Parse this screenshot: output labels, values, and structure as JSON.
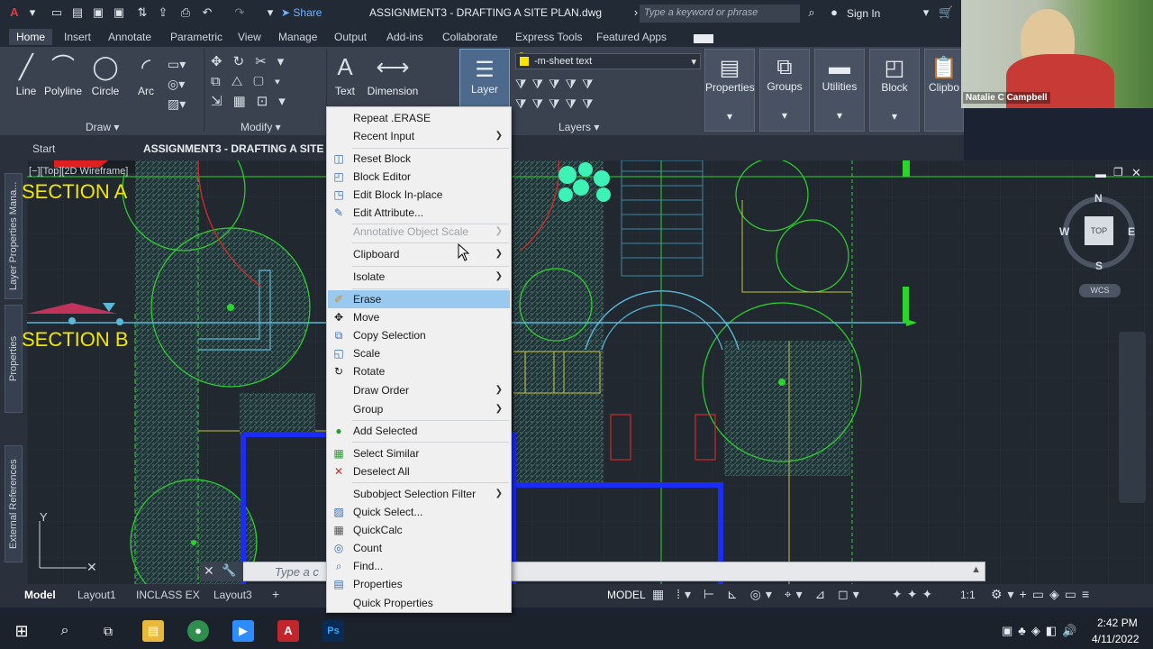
{
  "titlebar": {
    "share_label": "Share",
    "document_title": "ASSIGNMENT3 - DRAFTING A SITE PLAN.dwg",
    "search_placeholder": "Type a keyword or phrase",
    "signin_label": "Sign In"
  },
  "ribbon_tabs": [
    "Home",
    "Insert",
    "Annotate",
    "Parametric",
    "View",
    "Manage",
    "Output",
    "Add-ins",
    "Collaborate",
    "Express Tools",
    "Featured Apps"
  ],
  "ribbon": {
    "draw_tools": [
      "Line",
      "Polyline",
      "Circle",
      "Arc"
    ],
    "panel_draw": "Draw",
    "panel_modify": "Modify",
    "text_label": "Text",
    "dimension_label": "Dimension",
    "layer_label": "Layer",
    "layer_current": "-m-sheet text",
    "panel_layers": "Layers",
    "right_tools": [
      "Properties",
      "Groups",
      "Utilities",
      "Block",
      "Clipbo"
    ]
  },
  "doc_tabs": {
    "start": "Start",
    "active": "ASSIGNMENT3 - DRAFTING A SITE P"
  },
  "viewport": {
    "label": "[−][Top][2D Wireframe]",
    "section_a": "SECTION A",
    "section_b": "SECTION B"
  },
  "side_palettes": [
    "Layer Properties Mana...",
    "Properties",
    "External References"
  ],
  "viewcube": {
    "top": "TOP",
    "n": "N",
    "s": "S",
    "e": "E",
    "w": "W",
    "wcs": "WCS"
  },
  "command_placeholder": "Type a c",
  "model_tabs": [
    "Model",
    "Layout1",
    "INCLASS EX",
    "Layout3"
  ],
  "statusbar": {
    "model": "MODEL",
    "scale": "1:1"
  },
  "context_menu": [
    {
      "label": "Repeat .ERASE",
      "icon": "",
      "submenu": false
    },
    {
      "label": "Recent Input",
      "icon": "",
      "submenu": true
    },
    {
      "label": "Reset Block",
      "icon": "reset-block-icon",
      "submenu": false
    },
    {
      "label": "Block Editor",
      "icon": "block-editor-icon",
      "submenu": false
    },
    {
      "label": "Edit Block In-place",
      "icon": "edit-block-icon",
      "submenu": false
    },
    {
      "label": "Edit Attribute...",
      "icon": "edit-attribute-icon",
      "submenu": false
    },
    {
      "label": "Annotative Object Scale",
      "icon": "",
      "submenu": true,
      "disabled": true
    },
    {
      "label": "Clipboard",
      "icon": "",
      "submenu": true
    },
    {
      "label": "Isolate",
      "icon": "",
      "submenu": true
    },
    {
      "label": "Erase",
      "icon": "erase-icon",
      "submenu": false,
      "selected": true
    },
    {
      "label": "Move",
      "icon": "move-icon",
      "submenu": false
    },
    {
      "label": "Copy Selection",
      "icon": "copy-icon",
      "submenu": false
    },
    {
      "label": "Scale",
      "icon": "scale-icon",
      "submenu": false
    },
    {
      "label": "Rotate",
      "icon": "rotate-icon",
      "submenu": false
    },
    {
      "label": "Draw Order",
      "icon": "",
      "submenu": true
    },
    {
      "label": "Group",
      "icon": "",
      "submenu": true
    },
    {
      "label": "Add Selected",
      "icon": "add-selected-icon",
      "submenu": false
    },
    {
      "label": "Select Similar",
      "icon": "select-similar-icon",
      "submenu": false
    },
    {
      "label": "Deselect All",
      "icon": "deselect-icon",
      "submenu": false
    },
    {
      "label": "Subobject Selection Filter",
      "icon": "",
      "submenu": true
    },
    {
      "label": "Quick Select...",
      "icon": "quick-select-icon",
      "submenu": false
    },
    {
      "label": "QuickCalc",
      "icon": "calculator-icon",
      "submenu": false
    },
    {
      "label": "Count",
      "icon": "count-icon",
      "submenu": false
    },
    {
      "label": "Find...",
      "icon": "find-icon",
      "submenu": false
    },
    {
      "label": "Properties",
      "icon": "properties-icon",
      "submenu": false
    },
    {
      "label": "Quick Properties",
      "icon": "",
      "submenu": false
    }
  ],
  "webcam": {
    "name": "Natalie C Campbell"
  },
  "taskbar": {
    "time": "2:42 PM",
    "date": "4/11/2022"
  },
  "colors": {
    "accent": "#6fb2ff",
    "selection": "#99c9ef",
    "drawing_bg": "#212830"
  }
}
